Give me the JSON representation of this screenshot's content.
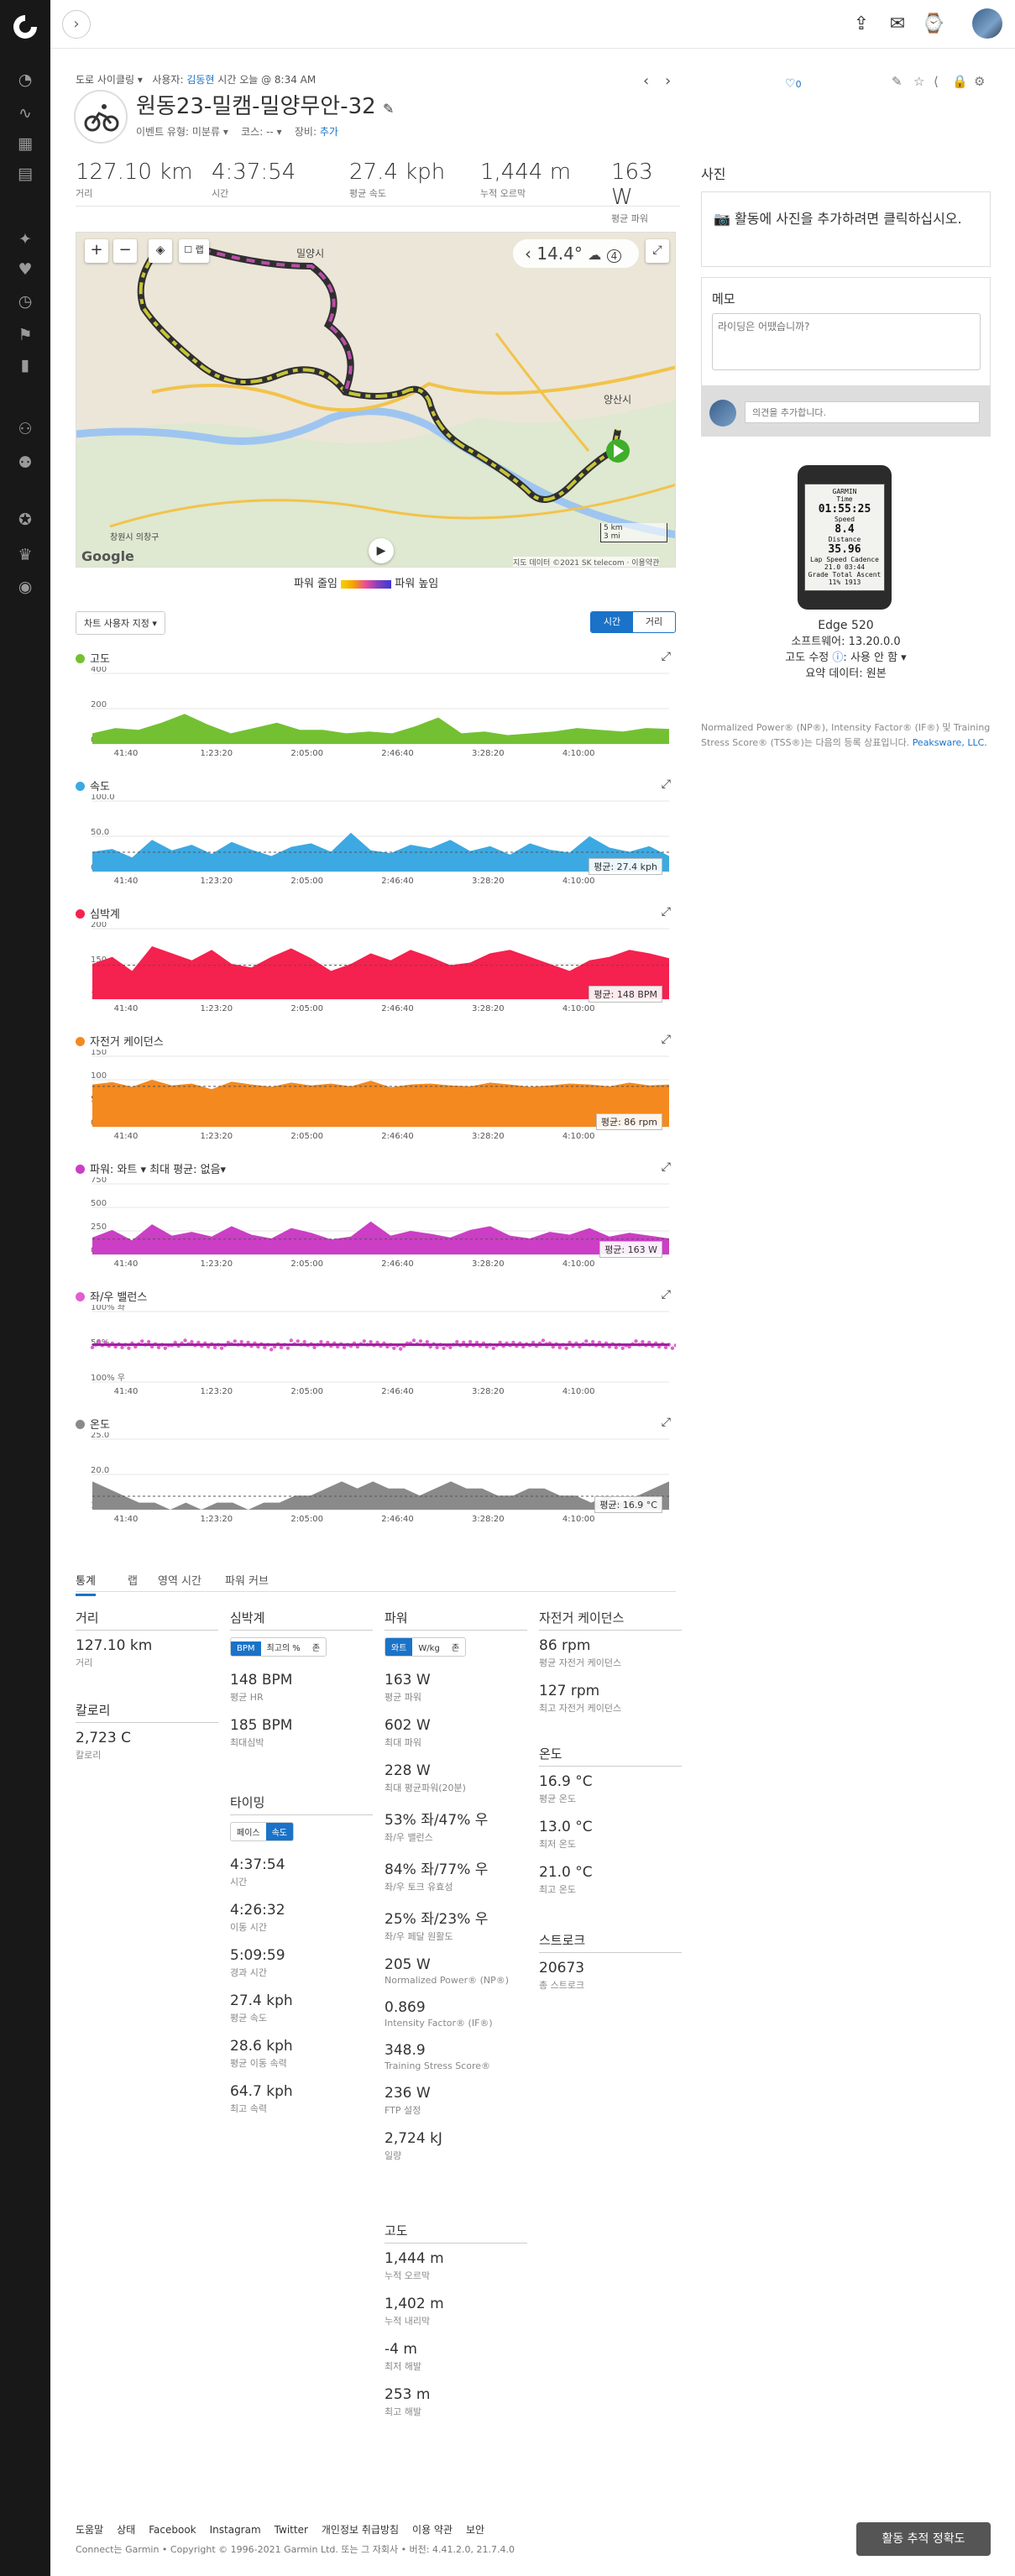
{
  "nav": {
    "sidebar_icons": [
      "dashboard-icon",
      "activities-icon",
      "calendar-icon",
      "news-icon",
      "training-icon",
      "health-icon",
      "clock-icon",
      "gear-shoe-icon",
      "reports-icon",
      "connections-icon",
      "groups-icon",
      "badges-icon",
      "challenges-icon",
      "insights-icon"
    ],
    "top_icons": [
      "upload-icon",
      "inbox-icon",
      "watch-icon"
    ]
  },
  "activity": {
    "breadcrumb": {
      "type": "도로 사이클링",
      "by": "사용자:",
      "user": "김동현",
      "time": "시간 오늘 @ 8:34 AM"
    },
    "title": "원동23-밀캠-밀양무안-32",
    "event_type_label": "이벤트 유형:",
    "event_type": "미분류",
    "course_label": "코스:",
    "course": "--",
    "gear_label": "장비:",
    "gear": "추가",
    "like_count": "0"
  },
  "summary": [
    {
      "value": "127.10 km",
      "label": "거리"
    },
    {
      "value": "4:37:54",
      "label": "시간"
    },
    {
      "value": "27.4 kph",
      "label": "평균 속도"
    },
    {
      "value": "1,444 m",
      "label": "누적 오르막"
    },
    {
      "value": "163 W",
      "label": "평균 파워"
    }
  ],
  "map": {
    "temp": "14.4°",
    "wind": "4",
    "places": [
      "밀양시",
      "양산시",
      "창원시 의창구"
    ],
    "scale_km": "5 km",
    "scale_mi": "3 mi",
    "copyright": "지도 데이터 ©2021 SK telecom · 이용약관",
    "google": "Google",
    "legend_low": "파워 줄임",
    "legend_high": "파워 높임"
  },
  "chart_controls": {
    "customize": "차트 사용자 지정",
    "time": "시간",
    "distance": "거리"
  },
  "charts": [
    {
      "title": "고도",
      "color": "#73c132",
      "ymax": 400,
      "ticks": [
        "400",
        "200",
        "0"
      ],
      "avg": ""
    },
    {
      "title": "속도",
      "color": "#3ca9e2",
      "ymax": 100,
      "ticks": [
        "100.0",
        "50.0",
        "0.0"
      ],
      "avg": "평균: 27.4 kph"
    },
    {
      "title": "심박계",
      "color": "#f5214e",
      "ymax": 200,
      "ticks": [
        "200",
        "150",
        "100"
      ],
      "avg": "평균: 148 BPM"
    },
    {
      "title": "자전거 케이던스",
      "color": "#f4891f",
      "ymax": 150,
      "ticks": [
        "150",
        "100",
        "50",
        "0"
      ],
      "avg": "평균: 86 rpm"
    },
    {
      "title": "파워: 와트 ▾   최대 평균: 없음▾",
      "color": "#cc3ec5",
      "ymax": 750,
      "ticks": [
        "750",
        "500",
        "250",
        "0"
      ],
      "avg": "평균: 163 W"
    },
    {
      "title": "좌/우 밸런스",
      "color": "#e060d0",
      "ymax": 100,
      "ticks": [
        "100% 좌",
        "50%",
        "100% 우"
      ],
      "avg": ""
    },
    {
      "title": "온도",
      "color": "#8a8a8a",
      "ymax": 25,
      "ticks": [
        "25.0",
        "20.0",
        "15.0"
      ],
      "avg": "평균: 16.9 °C"
    }
  ],
  "chart_xticks": [
    "41:40",
    "1:23:20",
    "2:05:00",
    "2:46:40",
    "3:28:20",
    "4:10:00"
  ],
  "tabs": [
    "통계",
    "랩",
    "영역 시간",
    "파워 커브"
  ],
  "stats": {
    "distance": {
      "title": "거리",
      "items": [
        {
          "v": "127.10 km",
          "l": "거리"
        }
      ]
    },
    "calories": {
      "title": "칼로리",
      "items": [
        {
          "v": "2,723 C",
          "l": "칼로리"
        }
      ]
    },
    "hr": {
      "title": "심박계",
      "seg": [
        "BPM",
        "최고의 %",
        "존"
      ],
      "items": [
        {
          "v": "148 BPM",
          "l": "평균 HR"
        },
        {
          "v": "185 BPM",
          "l": "최대심박"
        }
      ]
    },
    "timing": {
      "title": "타이밍",
      "seg": [
        "페이스",
        "속도"
      ],
      "items": [
        {
          "v": "4:37:54",
          "l": "시간"
        },
        {
          "v": "4:26:32",
          "l": "이동 시간"
        },
        {
          "v": "5:09:59",
          "l": "경과 시간"
        },
        {
          "v": "27.4 kph",
          "l": "평균 속도"
        },
        {
          "v": "28.6 kph",
          "l": "평균 이동 속력"
        },
        {
          "v": "64.7 kph",
          "l": "최고 속력"
        }
      ]
    },
    "power": {
      "title": "파워",
      "seg": [
        "와트",
        "W/kg",
        "존"
      ],
      "items": [
        {
          "v": "163 W",
          "l": "평균 파워"
        },
        {
          "v": "602 W",
          "l": "최대 파워"
        },
        {
          "v": "228 W",
          "l": "최대 평균파워(20분)"
        },
        {
          "v": "53% 좌/47% 우",
          "l": "좌/우 밸런스"
        },
        {
          "v": "84% 좌/77% 우",
          "l": "좌/우 토크 유효성"
        },
        {
          "v": "25% 좌/23% 우",
          "l": "좌/우 페달 원활도"
        },
        {
          "v": "205 W",
          "l": "Normalized Power® (NP®)"
        },
        {
          "v": "0.869",
          "l": "Intensity Factor® (IF®)"
        },
        {
          "v": "348.9",
          "l": "Training Stress Score®"
        },
        {
          "v": "236 W",
          "l": "FTP 설정"
        },
        {
          "v": "2,724 kJ",
          "l": "일량"
        }
      ]
    },
    "elevation": {
      "title": "고도",
      "items": [
        {
          "v": "1,444 m",
          "l": "누적 오르막"
        },
        {
          "v": "1,402 m",
          "l": "누적 내리막"
        },
        {
          "v": "-4 m",
          "l": "최저 해발"
        },
        {
          "v": "253 m",
          "l": "최고 해발"
        }
      ]
    },
    "cadence": {
      "title": "자전거 케이던스",
      "items": [
        {
          "v": "86 rpm",
          "l": "평균 자전거 케이던스"
        },
        {
          "v": "127 rpm",
          "l": "최고 자전거 케이던스"
        }
      ]
    },
    "temperature": {
      "title": "온도",
      "items": [
        {
          "v": "16.9 °C",
          "l": "평균 온도"
        },
        {
          "v": "13.0 °C",
          "l": "최저 온도"
        },
        {
          "v": "21.0 °C",
          "l": "최고 온도"
        }
      ]
    },
    "strokes": {
      "title": "스트로크",
      "items": [
        {
          "v": "20673",
          "l": "총 스트로크"
        }
      ]
    }
  },
  "right": {
    "photo_title": "사진",
    "photo_prompt": "활동에 사진을 추가하려면 클릭하십시오.",
    "memo_title": "메모",
    "memo_placeholder": "라이딩은 어땠습니까?",
    "comment_placeholder": "의견을 추가합니다.",
    "device_screen": [
      "GARMIN",
      "Time",
      "01:55:25",
      "Speed",
      "8.4",
      "Distance",
      "35.96",
      "Lap Speed  Cadence",
      "21.0  03:44",
      "Grade  Total Ascent",
      "11%  1913"
    ],
    "device_name": "Edge 520",
    "software": "소프트웨어: 13.20.0.0",
    "elev_corr_label": "고도 수정",
    "elev_corr_value": "사용 안 함",
    "summary_data": "요약 데이터: 원본",
    "trademark": "Normalized Power® (NP®), Intensity Factor® (IF®) 및 Training Stress Score® (TSS®)는 다음의 등록 상표입니다.",
    "trademark_link": "Peaksware, LLC."
  },
  "footer": {
    "links": [
      "도움말",
      "상태",
      "Facebook",
      "Instagram",
      "Twitter",
      "개인정보 취급방침",
      "이용 약관",
      "보안"
    ],
    "copyright": "Connect는 Garmin • Copyright © 1996-2021 Garmin Ltd. 또는 그 자회사 • 버전: 4.41.2.0, 21.7.4.0",
    "track_button": "활동 추적 정확도"
  },
  "chart_data": [
    {
      "type": "area",
      "title": "고도",
      "x": [
        "41:40",
        "1:23:20",
        "2:05:00",
        "2:46:40",
        "3:28:20",
        "4:10:00"
      ],
      "ylim": [
        0,
        400
      ],
      "series": [
        {
          "values": [
            60,
            90,
            80,
            120,
            170,
            110,
            60,
            90,
            120,
            80,
            80,
            60,
            70,
            60,
            100,
            150,
            60,
            70,
            50,
            60,
            70,
            90,
            80,
            70,
            90,
            85
          ]
        }
      ]
    },
    {
      "type": "area",
      "title": "속도",
      "x": [
        "41:40",
        "1:23:20",
        "2:05:00",
        "2:46:40",
        "3:28:20",
        "4:10:00"
      ],
      "ylim": [
        0,
        100
      ],
      "mean": 27.4,
      "series": [
        {
          "values": [
            28,
            32,
            20,
            45,
            30,
            38,
            25,
            42,
            31,
            22,
            35,
            40,
            28,
            55,
            30,
            26,
            38,
            33,
            45,
            29,
            36,
            24,
            40,
            31,
            27,
            50,
            34,
            28,
            36,
            22
          ]
        }
      ]
    },
    {
      "type": "area",
      "title": "심박계",
      "x": [
        "41:40",
        "1:23:20",
        "2:05:00",
        "2:46:40",
        "3:28:20",
        "4:10:00"
      ],
      "ylim": [
        100,
        200
      ],
      "mean": 148,
      "series": [
        {
          "values": [
            150,
            160,
            140,
            175,
            165,
            155,
            170,
            150,
            145,
            160,
            172,
            158,
            140,
            150,
            165,
            155,
            170,
            160,
            148,
            152,
            165,
            170,
            160,
            150,
            140,
            155,
            160,
            170,
            165,
            158
          ]
        }
      ]
    },
    {
      "type": "area",
      "title": "자전거 케이던스",
      "x": [
        "41:40",
        "1:23:20",
        "2:05:00",
        "2:46:40",
        "3:28:20",
        "4:10:00"
      ],
      "ylim": [
        0,
        150
      ],
      "mean": 86,
      "series": [
        {
          "values": [
            90,
            95,
            85,
            100,
            88,
            92,
            80,
            96,
            90,
            85,
            94,
            88,
            92,
            86,
            98,
            84,
            90,
            92,
            88,
            86,
            94,
            90,
            85,
            88,
            92,
            90,
            86,
            94,
            88,
            90
          ]
        }
      ]
    },
    {
      "type": "area",
      "title": "파워",
      "x": [
        "41:40",
        "1:23:20",
        "2:05:00",
        "2:46:40",
        "3:28:20",
        "4:10:00"
      ],
      "ylim": [
        0,
        750
      ],
      "mean": 163,
      "series": [
        {
          "values": [
            180,
            260,
            150,
            320,
            200,
            240,
            190,
            300,
            210,
            170,
            280,
            230,
            160,
            190,
            350,
            200,
            250,
            220,
            180,
            260,
            300,
            200,
            170,
            240,
            210,
            280,
            190,
            230,
            200,
            170
          ]
        }
      ]
    },
    {
      "type": "scatter",
      "title": "좌/우 밸런스",
      "x": [
        "41:40",
        "1:23:20",
        "2:05:00",
        "2:46:40",
        "3:28:20",
        "4:10:00"
      ],
      "ylim": [
        0,
        100
      ],
      "series": [
        {
          "values": [
            53,
            52,
            54,
            51,
            55,
            53,
            52,
            54,
            53,
            50,
            56,
            53,
            52,
            54,
            53,
            51,
            55,
            52,
            53,
            54,
            52,
            53,
            55,
            51,
            54,
            53,
            52,
            54,
            53,
            52
          ]
        }
      ]
    },
    {
      "type": "area",
      "title": "온도",
      "x": [
        "41:40",
        "1:23:20",
        "2:05:00",
        "2:46:40",
        "3:28:20",
        "4:10:00"
      ],
      "ylim": [
        15,
        25
      ],
      "mean": 16.9,
      "series": [
        {
          "values": [
            19,
            18,
            17,
            16,
            16,
            15,
            16,
            15,
            16,
            16,
            15,
            16,
            16,
            17,
            17,
            18,
            19,
            18,
            19,
            18,
            18,
            17,
            18,
            19,
            18,
            18,
            17,
            17,
            18,
            18,
            17,
            17,
            16,
            17,
            16,
            17,
            18,
            19
          ]
        }
      ]
    }
  ]
}
